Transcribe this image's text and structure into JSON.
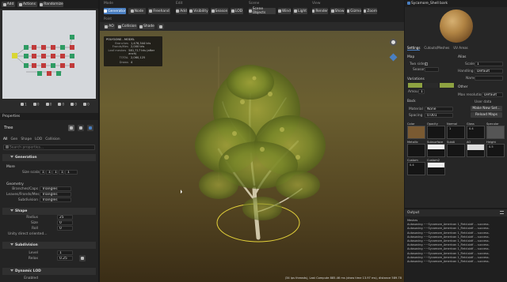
{
  "graph": {
    "toolbar": [
      "Add",
      "Actions",
      "Randomize"
    ],
    "counts": [
      "1",
      "0",
      "0",
      "0",
      "0",
      "0"
    ]
  },
  "properties": {
    "title": "Properties",
    "object": "Tree",
    "filter": [
      "All",
      "Gen",
      "Shape",
      "LOD",
      "Collision"
    ],
    "search_placeholder": "Search properties...",
    "generation": {
      "header": "Generation",
      "sub": "More",
      "size_scale_label": "Size scalar",
      "size_scale_values": [
        "1",
        "1",
        "1",
        "1",
        "1"
      ]
    },
    "geometry": {
      "header": "Geometry",
      "rows": [
        {
          "label": "Branches/Caps",
          "value": "Triangles"
        },
        {
          "label": "Leaves/Fronds/Mes",
          "value": "Triangles"
        },
        {
          "label": "Subdivision",
          "value": "Triangles"
        }
      ]
    },
    "shape": {
      "header": "Shape",
      "rows": [
        {
          "label": "Radius",
          "value": "25"
        },
        {
          "label": "Size",
          "value": "0"
        },
        {
          "label": "Roll",
          "value": "0"
        }
      ],
      "extra": "Unity direct oriented..."
    },
    "subdivision": {
      "header": "Subdivision",
      "level_label": "Level",
      "level_value": "1",
      "relax_label": "Relax",
      "relax_value": "0.25"
    },
    "dynamic_lod": {
      "header": "Dynamic LOD",
      "enabled": "Enabled"
    }
  },
  "toolbar": {
    "groups": [
      {
        "title": "Mode",
        "items": [
          "Generator",
          "Node",
          "Freehand"
        ]
      },
      {
        "title": "Edit",
        "items": [
          "Add",
          "Visibility",
          "Season",
          "LOD"
        ]
      },
      {
        "title": "Scene",
        "items": [
          "Scene Objects",
          "Wind",
          "Light"
        ]
      },
      {
        "title": "View",
        "items": [
          "Render",
          "Show",
          "Gizmo",
          "Zoom"
        ]
      }
    ],
    "point_label": "Point",
    "point_items": [
      "AO",
      "Collision",
      "Shade"
    ]
  },
  "stats": {
    "header": "POLYGONS - MODEL",
    "rows": [
      {
        "k": "Branches",
        "v": "1,476,344 tris"
      },
      {
        "k": "Fronds/Mes",
        "v": "2,000 tris"
      },
      {
        "k": "Leaf meshes",
        "v": "581,717 tris (after anch)"
      },
      {
        "k": "TOTAL",
        "v": "2,060,125"
      }
    ],
    "draws": {
      "k": "Draws",
      "v": "4"
    }
  },
  "viewport": {
    "status": "(34 ips threads), Last Compute 885.46 ms (draw time 13.97 ms), distance 589.78"
  },
  "material": {
    "name": "Sycamore_Shell bark",
    "tabs": [
      "Settings",
      "Cutouts/Meshes",
      "UV Areas"
    ],
    "map_section": "Map",
    "two_sided_label": "Two sided",
    "season_label": "Season",
    "variations_label": "Variations",
    "amount_label": "Amount",
    "amount_value": "1",
    "alias_section": "Alias",
    "scale_label": "Scale",
    "scale_value": "1",
    "handling_label": "Handling",
    "handling_value": "Default",
    "name_label": "Name",
    "other_section": "Other",
    "max_res_label": "Max resolution",
    "max_res_value": "Default",
    "user_data_label": "User data",
    "make_new_btn": "Make New Set...",
    "reload_btn": "Reload Maps",
    "back_section": "Back",
    "material_label": "Material",
    "material_value": "None",
    "spacing_label": "Spacing",
    "spacing_value": "0.001",
    "maps_row1": [
      "Color",
      "Opacity",
      "Normal",
      "Gloss",
      "Specular"
    ],
    "maps_row2": [
      "Metallic",
      "Subsurface",
      "SubAl",
      "AO",
      "Height"
    ],
    "maps_row3": [
      "Custom",
      "Custom2"
    ],
    "map_vals": [
      "0.4",
      "0.5",
      "1",
      "0.4"
    ]
  },
  "output": {
    "title": "Output",
    "header": "Meshes",
    "lines": [
      "Autosaving ~~Sycamore_American 1_Field.sbtf ... success.",
      "Autosaving ~~Sycamore_American 1_Field.sbtf ... success.",
      "Autosaving ~~Sycamore_American 1_Field.sbtf ... success.",
      "Autosaving ~~Sycamore_American 1_Field.sbtf ... success.",
      "Autosaving ~~Sycamore_American 1_Field.sbtf ... success.",
      "Autosaving ~~Sycamore_American 1_Field.sbtf ... success.",
      "Autosaving ~~Sycamore_American 1_Field.sbtf ... success.",
      "Autosaving ~~Sycamore_American 1_Field.sbtf ... success.",
      "Autosaving ~~Sycamore_American 1_Field.sbtf ... success.",
      "Autosaving ~~Sycamore_American 1_Field.sbtf ... success."
    ]
  },
  "colors": {
    "accent": "#4a7fc1",
    "viewport_top": "#5b5230",
    "viewport_bottom": "#3a2f18",
    "ring": "#e4d23a"
  }
}
